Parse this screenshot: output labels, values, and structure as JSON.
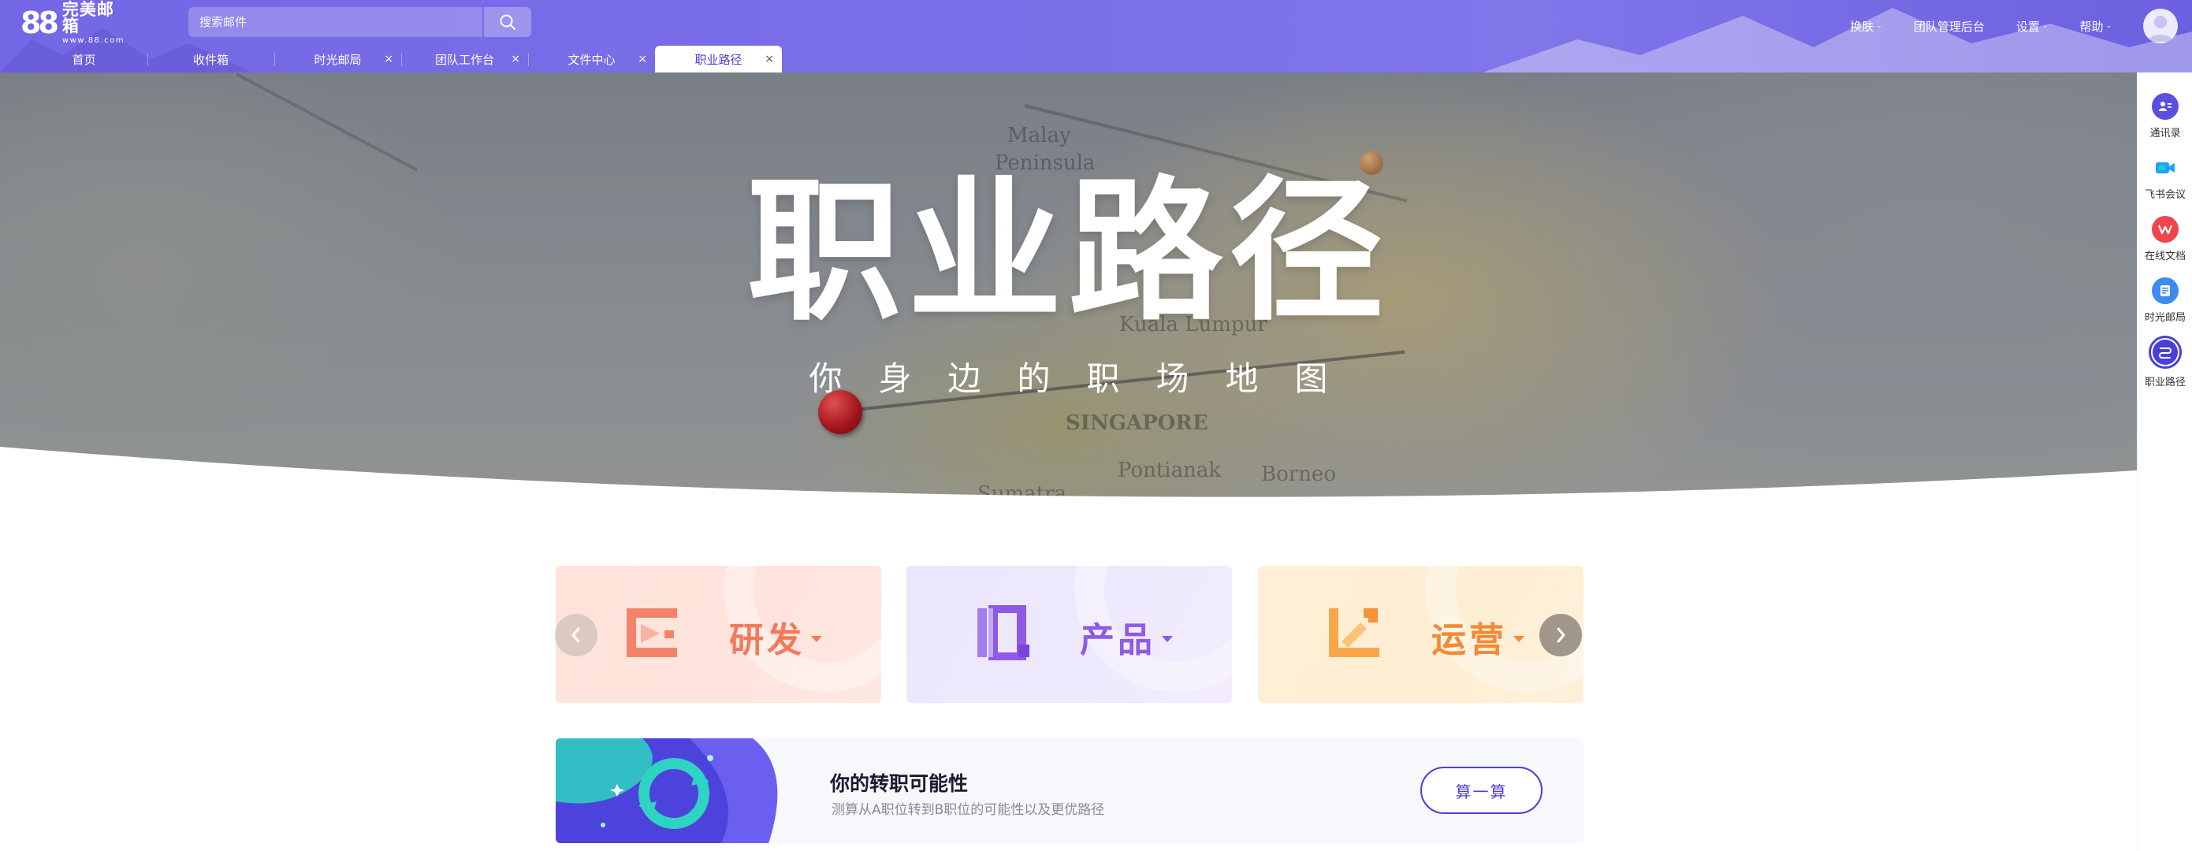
{
  "header": {
    "logo_number": "88",
    "logo_name": "完美邮箱",
    "logo_url": "www.88.com",
    "search_placeholder": "搜索邮件",
    "links": [
      {
        "label": "换肤",
        "has_caret": true
      },
      {
        "label": "团队管理后台",
        "has_caret": false
      },
      {
        "label": "设置",
        "has_caret": true
      },
      {
        "label": "帮助",
        "has_caret": true
      }
    ]
  },
  "tabs": [
    {
      "label": "首页",
      "closable": false,
      "active": false
    },
    {
      "label": "收件箱",
      "closable": false,
      "active": false
    },
    {
      "label": "时光邮局",
      "closable": true,
      "active": false
    },
    {
      "label": "团队工作台",
      "closable": true,
      "active": false
    },
    {
      "label": "文件中心",
      "closable": true,
      "active": false
    },
    {
      "label": "职业路径",
      "closable": true,
      "active": true
    }
  ],
  "hero": {
    "title": "职业路径",
    "subtitle": "你身边的职场地图",
    "map_labels": [
      "Malay",
      "Peninsula",
      "Kuala Lumpur",
      "SINGAPORE",
      "Pontianak",
      "Borneo",
      "Sumatra"
    ]
  },
  "sidebar": [
    {
      "label": "通讯录",
      "icon": "contacts-icon",
      "color": "#5b4fe0",
      "active": false
    },
    {
      "label": "飞书会议",
      "icon": "video-meeting-icon",
      "color": "#1aa3ff",
      "active": false
    },
    {
      "label": "在线文档",
      "icon": "wps-doc-icon",
      "color": "#f0454a",
      "active": false
    },
    {
      "label": "时光邮局",
      "icon": "time-mail-icon",
      "color": "#3d8bf0",
      "active": false
    },
    {
      "label": "职业路径",
      "icon": "career-path-icon",
      "color": "#4c3fd6",
      "active": true
    }
  ],
  "categories": [
    {
      "label": "研发",
      "key": "rd",
      "color": "#f07a5a"
    },
    {
      "label": "产品",
      "key": "pd",
      "color": "#8e5ae6"
    },
    {
      "label": "运营",
      "key": "op",
      "color": "#f28a38"
    }
  ],
  "transfer": {
    "title": "你的转职可能性",
    "description": "测算从A职位转到B职位的可能性以及更优路径",
    "button": "算一算"
  },
  "colors": {
    "header_bg": "#7467e6",
    "accent": "#4c3fd6",
    "active_tab_text": "#4d40d6"
  }
}
